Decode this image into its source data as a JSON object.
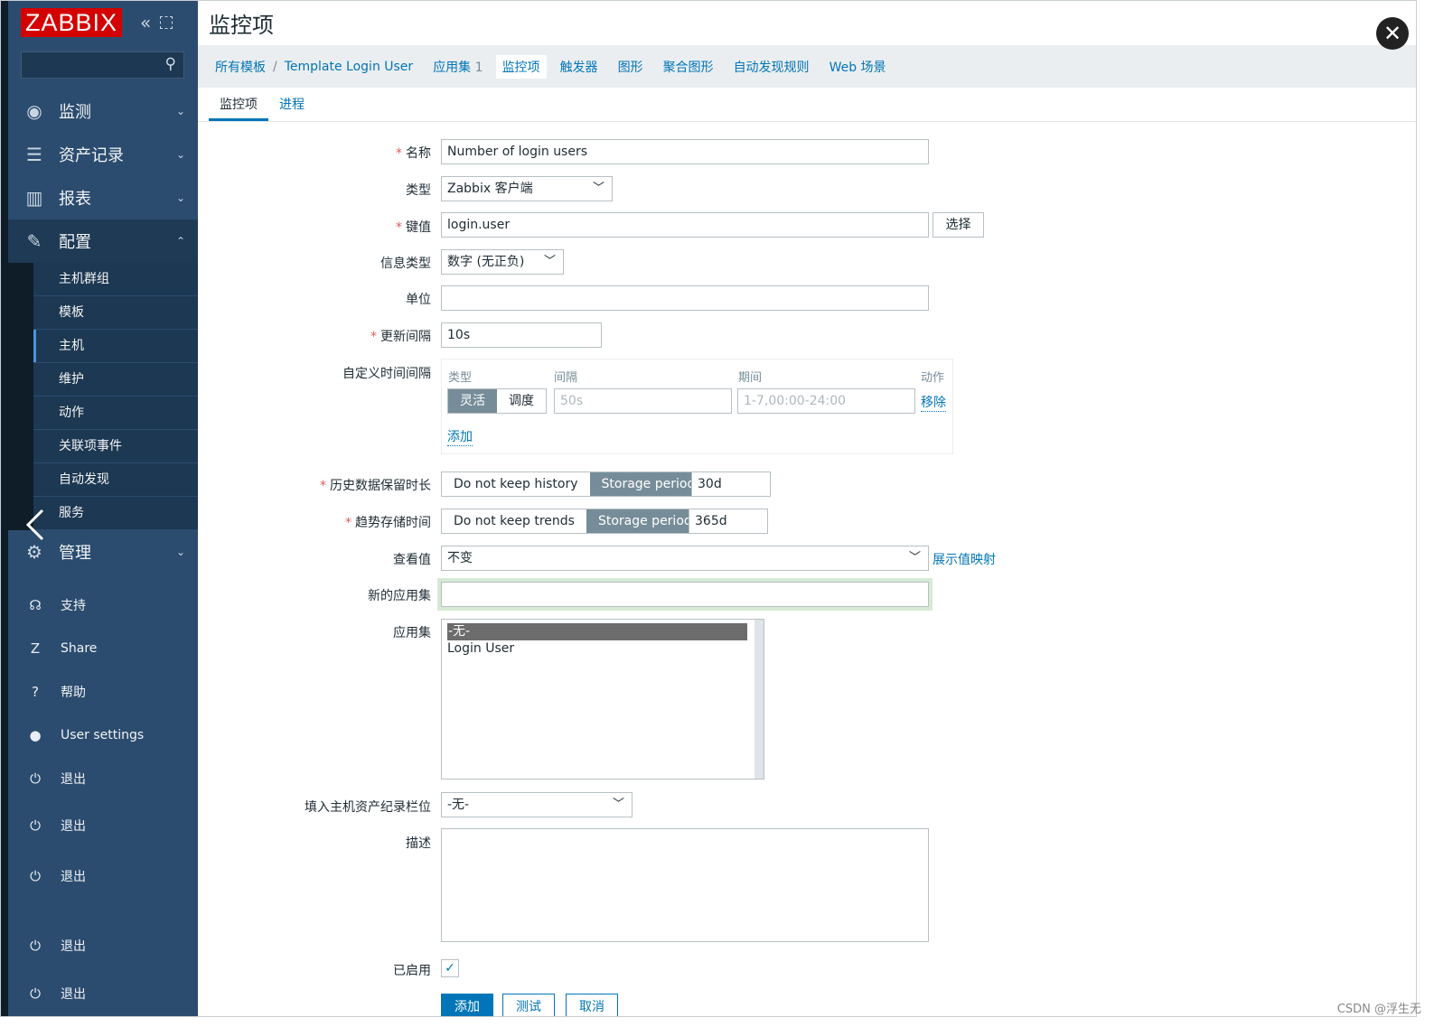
{
  "app": {
    "logo": "ZABBIX",
    "collapse_icon": "«",
    "kiosk_icon": "expand-icon"
  },
  "sidebar": {
    "search_placeholder": "",
    "menu": [
      {
        "label": "监测",
        "icon": "eye-icon",
        "glyph": "◉"
      },
      {
        "label": "资产记录",
        "icon": "list-icon",
        "glyph": "☰"
      },
      {
        "label": "报表",
        "icon": "chart-icon",
        "glyph": "▥"
      },
      {
        "label": "配置",
        "icon": "wrench-icon",
        "glyph": "🔧"
      },
      {
        "label": "管理",
        "icon": "gear-icon",
        "glyph": "⚙"
      }
    ],
    "config_sub": [
      "主机群组",
      "模板",
      "主机",
      "维护",
      "动作",
      "关联项事件",
      "自动发现",
      "服务"
    ],
    "lower": [
      {
        "label": "支持",
        "icon": "headset-icon",
        "glyph": "♫"
      },
      {
        "label": "Share",
        "icon": "share-icon",
        "glyph": "Z"
      },
      {
        "label": "帮助",
        "icon": "help-icon",
        "glyph": "?"
      },
      {
        "label": "User settings",
        "icon": "user-icon",
        "glyph": "●"
      },
      {
        "label": "退出",
        "icon": "power-icon",
        "glyph": "⏻"
      },
      {
        "label": "退出",
        "icon": "power-icon",
        "glyph": "⏻"
      },
      {
        "label": "退出",
        "icon": "power-icon",
        "glyph": "⏻"
      },
      {
        "label": "退出",
        "icon": "power-icon",
        "glyph": "⏻"
      },
      {
        "label": "退出",
        "icon": "power-icon",
        "glyph": "⏻"
      }
    ]
  },
  "header": {
    "title": "监控项",
    "close": "✕"
  },
  "nav": {
    "all_templates": "所有模板",
    "sep": "/",
    "template": "Template Login User",
    "apps": "应用集",
    "apps_count": "1",
    "items": "监控项",
    "triggers": "触发器",
    "graphs": "图形",
    "screens": "聚合图形",
    "discovery": "自动发现规则",
    "web": "Web 场景"
  },
  "tabs": {
    "item": "监控项",
    "process": "进程"
  },
  "form": {
    "name_label": "名称",
    "name_value": "Number of login users",
    "type_label": "类型",
    "type_value": "Zabbix 客户端",
    "key_label": "键值",
    "key_value": "login.user",
    "key_select": "选择",
    "info_label": "信息类型",
    "info_value": "数字 (无正负)",
    "units_label": "单位",
    "units_value": "",
    "interval_label": "更新间隔",
    "interval_value": "10s",
    "custom_label": "自定义时间间隔",
    "custom_head_type": "类型",
    "custom_head_interval": "间隔",
    "custom_head_period": "期间",
    "custom_head_action": "动作",
    "custom_flex": "灵活",
    "custom_sched": "调度",
    "custom_interval_ph": "50s",
    "custom_period_ph": "1-7,00:00-24:00",
    "custom_remove": "移除",
    "custom_add": "添加",
    "history_label": "历史数据保留时长",
    "history_off": "Do not keep history",
    "history_on": "Storage period",
    "history_value": "30d",
    "trends_label": "趋势存储时间",
    "trends_off": "Do not keep trends",
    "trends_on": "Storage period",
    "trends_value": "365d",
    "valuemap_label": "查看值",
    "valuemap_value": "不变",
    "valuemap_link": "展示值映射",
    "newapp_label": "新的应用集",
    "newapp_value": "",
    "apps_label": "应用集",
    "apps_options": [
      "-无-",
      "Login User"
    ],
    "inventory_label": "填入主机资产纪录栏位",
    "inventory_value": "-无-",
    "desc_label": "描述",
    "enabled_label": "已启用",
    "enabled_mark": "✓",
    "btn_add": "添加",
    "btn_test": "测试",
    "btn_cancel": "取消",
    "required_mark": "*"
  },
  "watermark": "CSDN @浮生无"
}
